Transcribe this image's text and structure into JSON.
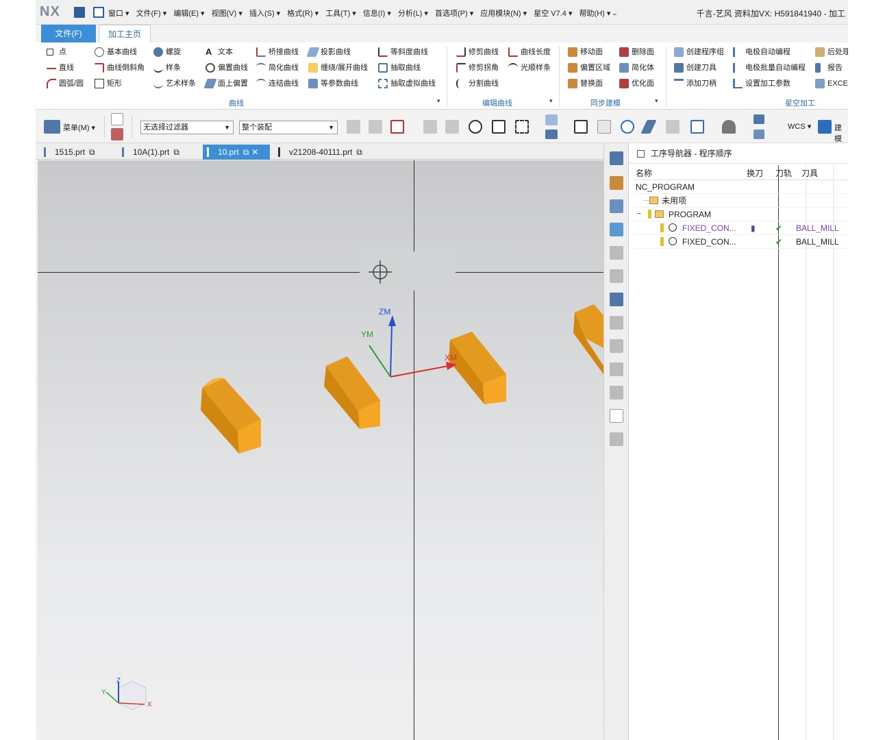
{
  "titlebar": {
    "logo": "NX",
    "menus": [
      "窗口 ▾",
      "文件(F) ▾",
      "编辑(E) ▾",
      "视图(V) ▾",
      "插入(S) ▾",
      "格式(R) ▾",
      "工具(T) ▾",
      "信息(I) ▾",
      "分析(L) ▾",
      "首选项(P) ▾",
      "应用模块(N) ▾",
      "星空 V7.4 ▾",
      "帮助(H) ▾ ₌"
    ],
    "title": "千言-艺风 资料加VX: H591841940 - 加工"
  },
  "ribbon_tabs": {
    "file": "文件(F)",
    "home": "加工主页"
  },
  "ribbon": {
    "curve_col1": [
      "点",
      "直线",
      "圆弧/圆"
    ],
    "curve_col2": [
      "基本曲线",
      "曲线倒斜角",
      "矩形"
    ],
    "curve_col3": [
      "螺旋",
      "样条",
      "艺术样条"
    ],
    "curve_col4": [
      "文本",
      "偏置曲线",
      "面上偏置"
    ],
    "curve_col5": [
      "桥接曲线",
      "简化曲线",
      "连结曲线"
    ],
    "curve_col6": [
      "投影曲线",
      "缠绕/展开曲线",
      "等参数曲线"
    ],
    "curve_col7": [
      "等斜度曲线",
      "抽取曲线",
      "抽取虚拟曲线"
    ],
    "edit_col1": [
      "修剪曲线",
      "修剪拐角",
      "分割曲线"
    ],
    "edit_col2": [
      "曲线长度",
      "光顺样条"
    ],
    "sync_col1": [
      "移动面",
      "偏置区域",
      "替换面"
    ],
    "sync_col2": [
      "删除面",
      "简化体",
      "优化面"
    ],
    "xk_col1": [
      "创建程序组",
      "创建刀具",
      "添加刀柄"
    ],
    "xk_col2": [
      "电极自动编程",
      "电极批量自动编程",
      "设置加工参数"
    ],
    "xk_col3": [
      "后处理",
      "报告",
      "EXCE"
    ],
    "groups": {
      "curve": "曲线",
      "edit": "编辑曲线",
      "sync": "同步建模",
      "xk": "星空加工"
    }
  },
  "toolbar": {
    "menu_label": "菜单(M) ▾",
    "filter_value": "无选择过滤器",
    "assembly_value": "整个装配",
    "wcs_label": "WCS ▾",
    "build_label": "建模"
  },
  "doc_tabs": [
    {
      "label": "1515.prt",
      "active": false
    },
    {
      "label": "10A(1).prt",
      "active": false
    },
    {
      "label": "10.prt",
      "active": true
    },
    {
      "label": "v21208-40111.prt",
      "active": false
    }
  ],
  "viewport": {
    "axis_labels": {
      "zm": "ZM",
      "ym": "YM",
      "xm": "XM"
    },
    "triad_labels": {
      "x": "X",
      "y": "Y",
      "z": "Z"
    }
  },
  "navigator": {
    "title": "工序导航器 - 程序顺序",
    "columns": [
      "名称",
      "换刀",
      "刀轨",
      "刀具"
    ],
    "rows": [
      {
        "name": "NC_PROGRAM",
        "change": "",
        "path": "",
        "tool": ""
      },
      {
        "name": "未用项",
        "change": "",
        "path": "",
        "tool": ""
      },
      {
        "name": "PROGRAM",
        "change": "",
        "path": "",
        "tool": ""
      },
      {
        "name": "FIXED_CON...",
        "change": "▮",
        "path": "✔",
        "tool": "BALL_MILL"
      },
      {
        "name": "FIXED_CON...",
        "change": "",
        "path": "✔",
        "tool": "BALL_MILL"
      }
    ]
  },
  "colors": {
    "accent": "#3c8fd6",
    "part_orange": "#f5a623",
    "check_green": "#1a9e1a",
    "link_purple": "#7a3fc0"
  }
}
